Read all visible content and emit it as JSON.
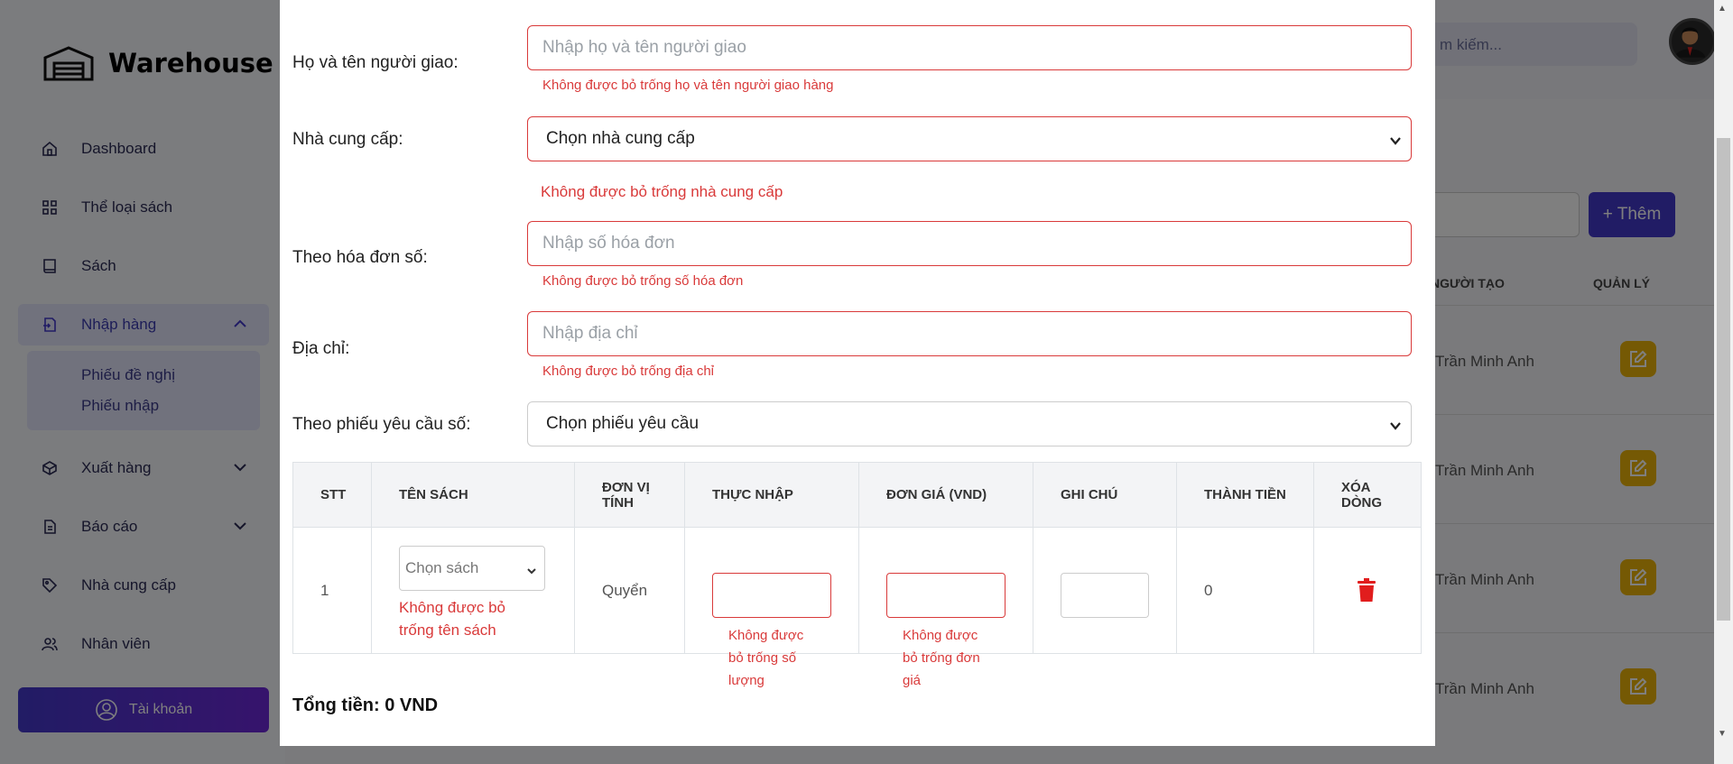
{
  "app": {
    "name": "Warehouse"
  },
  "sidebar": {
    "items": [
      {
        "label": "Dashboard",
        "icon": "home-icon"
      },
      {
        "label": "Thể loại sách",
        "icon": "grid-icon"
      },
      {
        "label": "Sách",
        "icon": "book-icon"
      },
      {
        "label": "Nhập hàng",
        "icon": "import-icon",
        "active": true
      },
      {
        "label": "Xuất hàng",
        "icon": "export-icon"
      },
      {
        "label": "Báo cáo",
        "icon": "report-icon"
      },
      {
        "label": "Nhà cung cấp",
        "icon": "tag-icon"
      },
      {
        "label": "Nhân viên",
        "icon": "users-icon"
      }
    ],
    "subitems": [
      "Phiếu đề nghị",
      "Phiếu nhập"
    ],
    "account_label": "Tài khoản"
  },
  "topbar": {
    "search_placeholder": "m kiếm..."
  },
  "background": {
    "add_label": "+ Thêm",
    "col_creator": "NGƯỜI TẠO",
    "col_manage": "QUẢN LÝ",
    "rows": [
      "Trần Minh Anh",
      "Trần Minh Anh",
      "Trần Minh Anh",
      "Trần Minh Anh"
    ]
  },
  "form": {
    "deliverer": {
      "label": "Họ và tên người giao:",
      "placeholder": "Nhập họ và tên người giao",
      "error": "Không được bỏ trống họ và tên người giao hàng"
    },
    "supplier": {
      "label": "Nhà cung cấp:",
      "value": "Chọn nhà cung cấp",
      "error": "Không được bỏ trống nhà cung cấp"
    },
    "invoice": {
      "label": "Theo hóa đơn số:",
      "placeholder": "Nhập số hóa đơn",
      "error": "Không được bỏ trống số hóa đơn"
    },
    "address": {
      "label": "Địa chỉ:",
      "placeholder": "Nhập địa chỉ",
      "error": "Không được bỏ trống địa chỉ"
    },
    "request": {
      "label": "Theo phiếu yêu cầu số:",
      "value": "Chọn phiếu yêu cầu"
    }
  },
  "table": {
    "headers": [
      "STT",
      "TÊN SÁCH",
      "ĐƠN VỊ TÍNH",
      "THỰC NHẬP",
      "ĐƠN GIÁ (VND)",
      "GHI CHÚ",
      "THÀNH TIỀN",
      "XÓA DÒNG"
    ],
    "row": {
      "stt": "1",
      "book_select": "Chọn sách",
      "book_error": "Không được bỏ trống tên sách",
      "unit": "Quyển",
      "qty_error": "Không được bỏ trống số lượng",
      "price_error": "Không được bỏ trống đơn giá",
      "total": "0"
    }
  },
  "total_label": "Tổng tiền: 0 VND",
  "colors": {
    "accent": "#4338ca",
    "error": "#d93a3a",
    "edit": "#eab308",
    "delete": "#e11d1d"
  }
}
